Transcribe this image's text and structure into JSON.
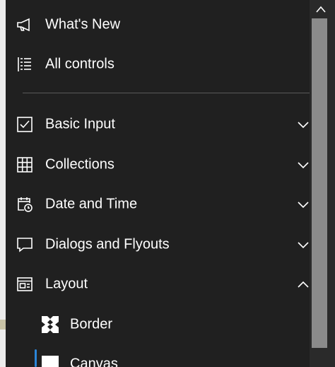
{
  "nav": {
    "whats_new": "What's New",
    "all_controls": "All controls",
    "basic_input": "Basic Input",
    "collections": "Collections",
    "date_and_time": "Date and Time",
    "dialogs_and_flyouts": "Dialogs and Flyouts",
    "layout": "Layout",
    "layout_children": {
      "border": "Border",
      "canvas": "Canvas"
    }
  },
  "icons": {
    "whats_new": "megaphone-icon",
    "all_controls": "list-icon",
    "basic_input": "checkbox-icon",
    "collections": "grid-icon",
    "date_and_time": "calendar-clock-icon",
    "dialogs_and_flyouts": "speech-bubble-icon",
    "layout": "layout-icon",
    "border": "border-icon",
    "canvas": "canvas-icon",
    "expand": "chevron-down-icon",
    "collapse": "chevron-up-icon"
  },
  "colors": {
    "background": "#202020",
    "text": "#ffffff",
    "selection_accent": "#2b86d9",
    "scrollbar_thumb": "#8b8b8b"
  }
}
